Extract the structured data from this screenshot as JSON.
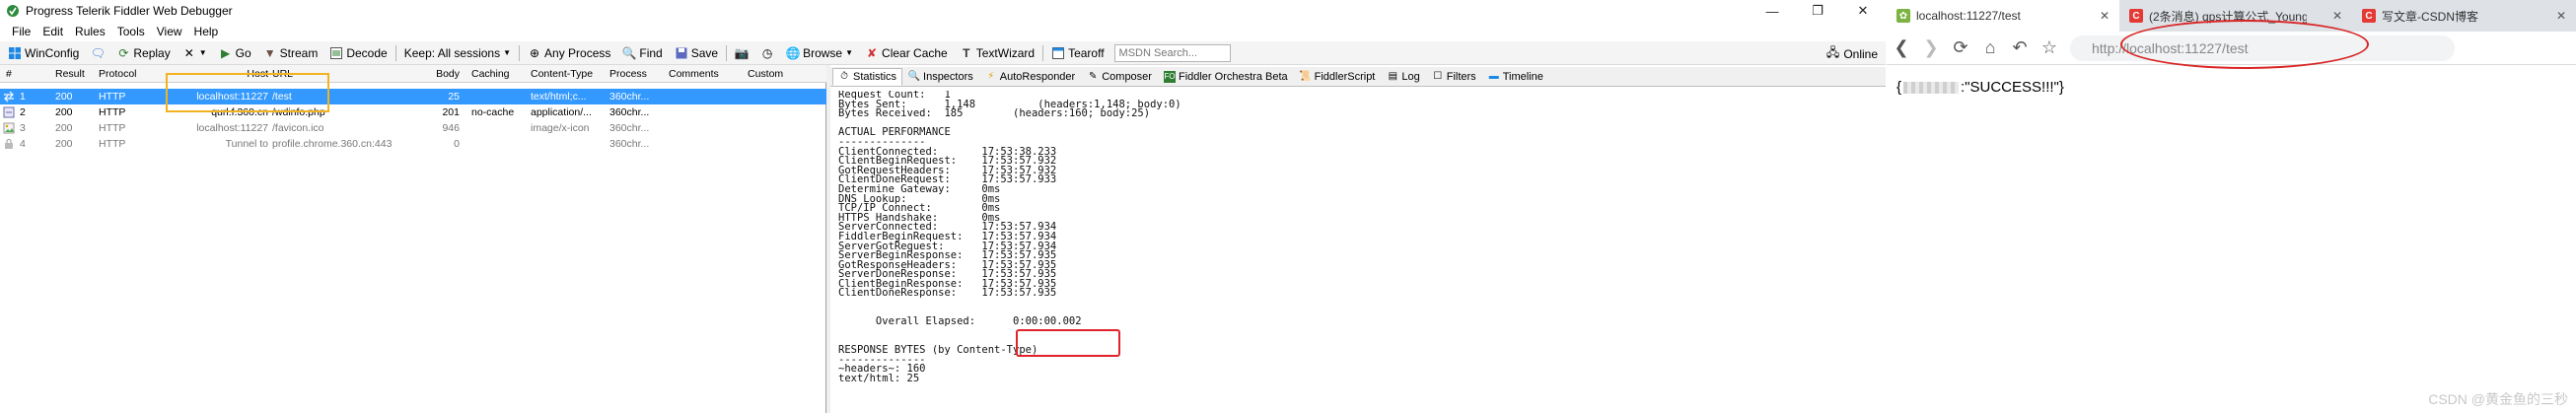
{
  "fiddler": {
    "title": "Progress Telerik Fiddler Web Debugger",
    "menu": [
      "File",
      "Edit",
      "Rules",
      "Tools",
      "View",
      "Help"
    ],
    "toolbar": {
      "winconfig": "WinConfig",
      "replay": "Replay",
      "go": "Go",
      "stream": "Stream",
      "decode": "Decode",
      "keep": "Keep: All sessions",
      "any_process": "Any Process",
      "find": "Find",
      "save": "Save",
      "browse": "Browse",
      "clear_cache": "Clear Cache",
      "textwizard": "TextWizard",
      "tearoff": "Tearoff",
      "msdn_placeholder": "MSDN Search...",
      "online": "Online"
    },
    "columns": [
      "#",
      "Result",
      "Protocol",
      "Host",
      "URL",
      "Body",
      "Caching",
      "Content-Type",
      "Process",
      "Comments",
      "Custom"
    ],
    "sessions": [
      {
        "num": "1",
        "result": "200",
        "protocol": "HTTP",
        "host": "localhost:11227",
        "url": "/test",
        "body": "25",
        "caching": "",
        "ctype": "text/html;c...",
        "process": "360chr..."
      },
      {
        "num": "2",
        "result": "200",
        "protocol": "HTTP",
        "host": "qurl.f.360.cn",
        "url": "/wdinfo.php",
        "body": "201",
        "caching": "no-cache",
        "ctype": "application/...",
        "process": "360chr..."
      },
      {
        "num": "3",
        "result": "200",
        "protocol": "HTTP",
        "host": "localhost:11227",
        "url": "/favicon.ico",
        "body": "946",
        "caching": "",
        "ctype": "image/x-icon",
        "process": "360chr..."
      },
      {
        "num": "4",
        "result": "200",
        "protocol": "HTTP",
        "host": "Tunnel to",
        "url": "profile.chrome.360.cn:443",
        "body": "0",
        "caching": "",
        "ctype": "",
        "process": "360chr..."
      }
    ],
    "tabs": [
      "Statistics",
      "Inspectors",
      "AutoResponder",
      "Composer",
      "Fiddler Orchestra Beta",
      "FiddlerScript",
      "Log",
      "Filters",
      "Timeline"
    ],
    "stats_lines": [
      "Request Count:   1",
      "Bytes Sent:      1,148          (headers:1,148; body:0)",
      "Bytes Received:  185        (headers:160; body:25)",
      "",
      "ACTUAL PERFORMANCE",
      "--------------",
      "ClientConnected:       17:53:38.233",
      "ClientBeginRequest:    17:53:57.932",
      "GotRequestHeaders:     17:53:57.932",
      "ClientDoneRequest:     17:53:57.933",
      "Determine Gateway:     0ms",
      "DNS Lookup:            0ms",
      "TCP/IP Connect:        0ms",
      "HTTPS Handshake:       0ms",
      "ServerConnected:       17:53:57.934",
      "FiddlerBeginRequest:   17:53:57.934",
      "ServerGotRequest:      17:53:57.934",
      "ServerBeginResponse:   17:53:57.935",
      "GotResponseHeaders:    17:53:57.935",
      "ServerDoneResponse:    17:53:57.935",
      "ClientBeginResponse:   17:53:57.935",
      "ClientDoneResponse:    17:53:57.935",
      "",
      "",
      "      Overall Elapsed:      0:00:00.002",
      "",
      "",
      "RESPONSE BYTES (by Content-Type)",
      "--------------",
      "~headers~: 160",
      "text/html: 25"
    ]
  },
  "browser": {
    "tabs": [
      {
        "label": "localhost:11227/test",
        "favicon_color": "#7cb342",
        "active": true
      },
      {
        "label": "(2条消息) qps计算公式_Young",
        "favicon_color": "#e53935",
        "active": false
      },
      {
        "label": "写文章-CSDN博客",
        "favicon_color": "#e53935",
        "active": false
      }
    ],
    "url": "http://localhost:11227/test",
    "body_prefix": "{",
    "body_text": ":\"SUCCESS!!!\"}",
    "watermark": "CSDN @黄金鱼的三秒"
  },
  "colors": {
    "selected_row": "#3399ff",
    "yellow_highlight": "#f2b321",
    "red_highlight": "#e0232a"
  }
}
